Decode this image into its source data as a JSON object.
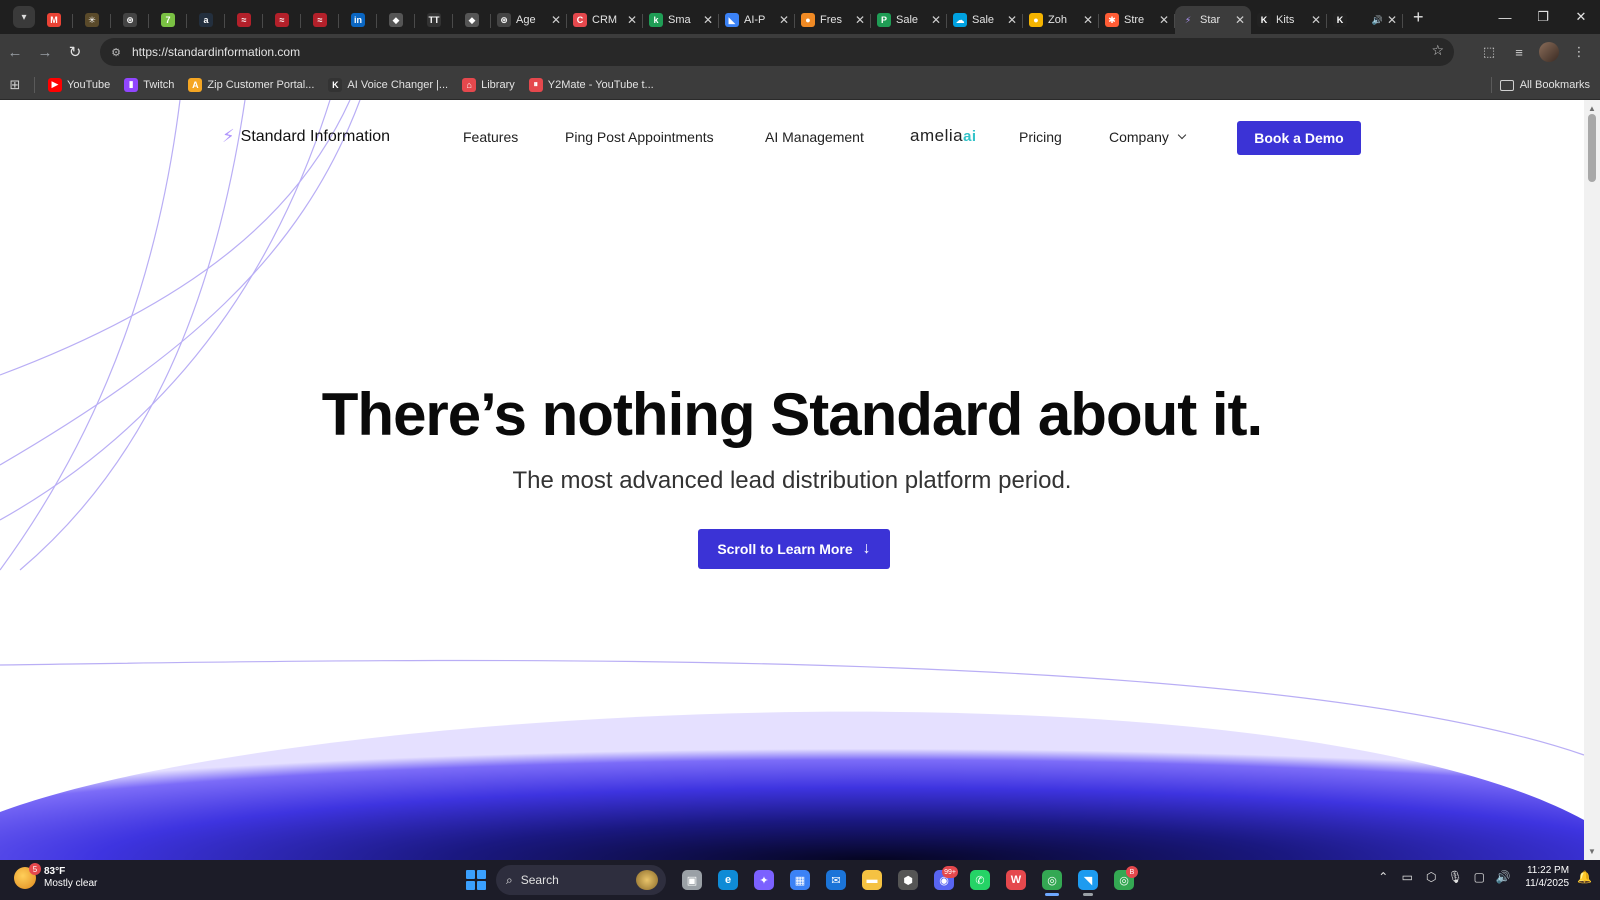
{
  "browser": {
    "tabs": [
      {
        "kind": "pinned",
        "icon": "chevron-down-icon",
        "glyph": "▾",
        "color": "#3a3a3a"
      },
      {
        "kind": "pinned",
        "icon": "gmail-icon",
        "glyph": "M",
        "color": "#ea4335"
      },
      {
        "kind": "pinned",
        "icon": "bee-icon",
        "glyph": "✳",
        "color": "#5a4a2a"
      },
      {
        "kind": "pinned",
        "icon": "chatgpt-icon",
        "glyph": "⊛",
        "color": "#444444"
      },
      {
        "kind": "pinned",
        "icon": "seven-icon",
        "glyph": "7",
        "color": "#7ac143"
      },
      {
        "kind": "pinned",
        "icon": "amazon-icon",
        "glyph": "a",
        "color": "#232f3e"
      },
      {
        "kind": "pinned",
        "icon": "red-logo-icon",
        "glyph": "≈",
        "color": "#b3202a"
      },
      {
        "kind": "pinned",
        "icon": "red-logo-icon",
        "glyph": "≈",
        "color": "#b3202a"
      },
      {
        "kind": "pinned",
        "icon": "red-logo-icon",
        "glyph": "≈",
        "color": "#b3202a"
      },
      {
        "kind": "pinned",
        "icon": "linkedin-icon",
        "glyph": "in",
        "color": "#0a66c2"
      },
      {
        "kind": "pinned",
        "icon": "diamond-icon",
        "glyph": "◆",
        "color": "#555555"
      },
      {
        "kind": "pinned",
        "icon": "tt-icon",
        "glyph": "TT",
        "color": "#333333"
      },
      {
        "kind": "pinned",
        "icon": "diamond-icon",
        "glyph": "◆",
        "color": "#555555"
      },
      {
        "kind": "open",
        "title": "Age",
        "icon": "openai-icon",
        "glyph": "⊛",
        "color": "#444444"
      },
      {
        "kind": "open",
        "title": "CRM",
        "icon": "crm-icon",
        "glyph": "C",
        "color": "#e5484d"
      },
      {
        "kind": "open",
        "title": "Sma",
        "icon": "k-icon",
        "glyph": "k",
        "color": "#1f9d55"
      },
      {
        "kind": "open",
        "title": "AI-P",
        "icon": "flag-icon",
        "glyph": "◣",
        "color": "#3b82f6"
      },
      {
        "kind": "open",
        "title": "Fres",
        "icon": "freshworks-icon",
        "glyph": "●",
        "color": "#f08a24"
      },
      {
        "kind": "open",
        "title": "Sale",
        "icon": "p-icon",
        "glyph": "P",
        "color": "#1f9d55"
      },
      {
        "kind": "open",
        "title": "Sale",
        "icon": "salesforce-icon",
        "glyph": "☁",
        "color": "#00a1e0"
      },
      {
        "kind": "open",
        "title": "Zoh",
        "icon": "zoho-icon",
        "glyph": "●",
        "color": "#f5b400"
      },
      {
        "kind": "open",
        "title": "Stre",
        "icon": "hubspot-icon",
        "glyph": "✱",
        "color": "#ff5c35"
      },
      {
        "kind": "open",
        "title": "Star",
        "icon": "bolt-icon",
        "glyph": "⚡",
        "color": "#3c3c3c",
        "active": true
      },
      {
        "kind": "open",
        "title": "Kits",
        "icon": "kits-icon",
        "glyph": "K",
        "color": "#222222"
      },
      {
        "kind": "open",
        "title": "",
        "icon": "kits-icon",
        "glyph": "K",
        "color": "#222222",
        "audio": true
      }
    ],
    "url": "https://standardinformation.com",
    "bookmarks": [
      {
        "label": "YouTube",
        "icon": "youtube-icon",
        "glyph": "▶",
        "color": "#ff0000"
      },
      {
        "label": "Twitch",
        "icon": "twitch-icon",
        "glyph": "▮",
        "color": "#9146ff"
      },
      {
        "label": "Zip Customer Portal...",
        "icon": "zip-icon",
        "glyph": "A",
        "color": "#f5a623"
      },
      {
        "label": "AI Voice Changer |...",
        "icon": "voice-changer-icon",
        "glyph": "K",
        "color": "#333333"
      },
      {
        "label": "Library",
        "icon": "library-icon",
        "glyph": "⌂",
        "color": "#e5484d"
      },
      {
        "label": "Y2Mate - YouTube t...",
        "icon": "y2mate-icon",
        "glyph": "⏸",
        "color": "#e5484d"
      }
    ],
    "all_bookmarks": "All Bookmarks"
  },
  "site": {
    "logo_text": "Standard Information",
    "nav": {
      "features": "Features",
      "ping_post": "Ping Post Appointments",
      "ai_management": "AI Management",
      "amelia_word": "amelia",
      "amelia_ai": "ai",
      "pricing": "Pricing",
      "company": "Company",
      "book_demo": "Book a Demo"
    },
    "hero": {
      "title": "There’s nothing Standard about it.",
      "subtitle": "The most advanced lead distribution platform period.",
      "cta": "Scroll to Learn More",
      "cta_arrow": "↓"
    },
    "colors": {
      "accent": "#3b33d6",
      "line": "#b9aef5"
    }
  },
  "taskbar": {
    "weather": {
      "temp": "83°F",
      "condition": "Mostly clear",
      "badge": "5"
    },
    "search_label": "Search",
    "apps": [
      {
        "name": "task-view-icon",
        "glyph": "▣",
        "color": "#9aa0a6",
        "running": false
      },
      {
        "name": "edge-icon",
        "glyph": "e",
        "color": "#0f8bd6",
        "running": false
      },
      {
        "name": "copilot-icon",
        "glyph": "✦",
        "color": "#7b61ff",
        "running": false
      },
      {
        "name": "store-icon",
        "glyph": "▦",
        "color": "#3b82f6",
        "running": false
      },
      {
        "name": "mail-icon",
        "glyph": "✉",
        "color": "#1b74d8",
        "running": false
      },
      {
        "name": "file-explorer-icon",
        "glyph": "▬",
        "color": "#f5c242",
        "running": false
      },
      {
        "name": "cube-app-icon",
        "glyph": "⬢",
        "color": "#555555",
        "running": false
      },
      {
        "name": "discord-icon",
        "glyph": "◉",
        "color": "#5865f2",
        "running": false,
        "badge": "99+"
      },
      {
        "name": "whatsapp-icon",
        "glyph": "✆",
        "color": "#25d366",
        "running": false
      },
      {
        "name": "wps-icon",
        "glyph": "W",
        "color": "#e5484d",
        "running": false
      },
      {
        "name": "chrome-icon",
        "glyph": "◎",
        "color": "#34a853",
        "running": true,
        "focused": true
      },
      {
        "name": "bird-app-icon",
        "glyph": "◥",
        "color": "#1d9bf0",
        "running": true
      },
      {
        "name": "chrome-profile-icon",
        "glyph": "◎",
        "color": "#34a853",
        "running": false,
        "badge": "B"
      }
    ],
    "tray_icons": [
      {
        "name": "chevron-up-icon",
        "glyph": "⌃"
      },
      {
        "name": "battery-icon",
        "glyph": "▭"
      },
      {
        "name": "shield-icon",
        "glyph": "⬡"
      },
      {
        "name": "mic-icon",
        "glyph": "🎙"
      },
      {
        "name": "network-icon",
        "glyph": "▢"
      },
      {
        "name": "volume-icon",
        "glyph": "🔊"
      }
    ],
    "time": "11:22 PM",
    "date": "11/4/2025"
  }
}
